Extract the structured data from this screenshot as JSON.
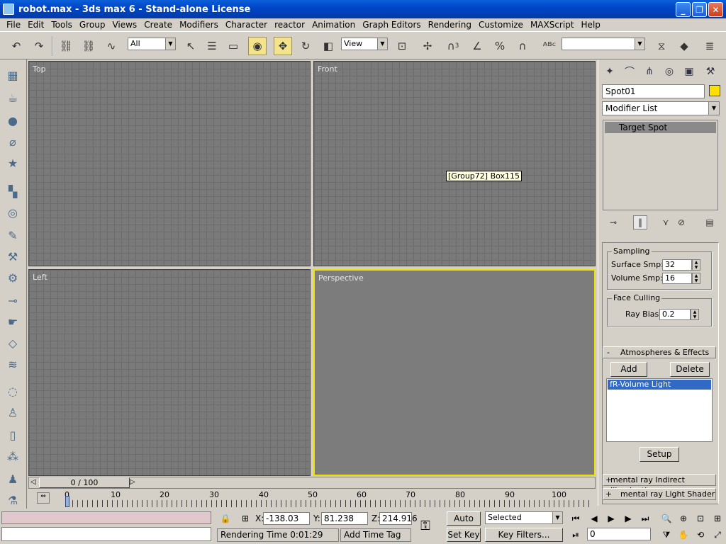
{
  "window": {
    "title": "robot.max - 3ds max 6 - Stand-alone License",
    "buttons": {
      "minimize": "_",
      "maximize": "❐",
      "close": "✕"
    }
  },
  "menu": [
    "File",
    "Edit",
    "Tools",
    "Group",
    "Views",
    "Create",
    "Modifiers",
    "Character",
    "reactor",
    "Animation",
    "Graph Editors",
    "Rendering",
    "Customize",
    "MAXScript",
    "Help"
  ],
  "toolbar": {
    "selection_filter": "All",
    "reference_coord": "View",
    "snap_angle": "3",
    "named_selection": ""
  },
  "viewports": {
    "top": {
      "label": "Top"
    },
    "front": {
      "label": "Front"
    },
    "left": {
      "label": "Left"
    },
    "perspective": {
      "label": "Perspective"
    }
  },
  "tooltip": "[Group72] Box115",
  "command_panel": {
    "object_name": "Spot01",
    "object_color": "#ffe000",
    "modifier_list": "Modifier List",
    "stack_item": "Target Spot",
    "sampling": {
      "title": "Sampling",
      "surface_label": "Surface Smp:",
      "surface_value": "32",
      "volume_label": "Volume Smp:",
      "volume_value": "16"
    },
    "face_culling": {
      "title": "Face Culling",
      "ray_bias_label": "Ray Bias:",
      "ray_bias_value": "0.2"
    },
    "atmospheres": {
      "toggle": "-",
      "title": "Atmospheres & Effects",
      "add": "Add",
      "delete": "Delete",
      "items": [
        "fR-Volume Light"
      ],
      "setup": "Setup"
    },
    "rollup_mr_indirect": {
      "toggle": "+",
      "title": "mental ray Indirect Illumination"
    },
    "rollup_mr_shader": {
      "toggle": "+",
      "title": "mental ray Light Shader"
    }
  },
  "time_slider": {
    "frame_display": "0 / 100",
    "ticks": [
      "0",
      "10",
      "20",
      "30",
      "40",
      "50",
      "60",
      "70",
      "80",
      "90",
      "100"
    ]
  },
  "status": {
    "x_label": "X:",
    "x_value": "-138.03",
    "y_label": "Y:",
    "y_value": "81.238",
    "z_label": "Z:",
    "z_value": "214.916",
    "rendering_time": "Rendering Time  0:01:29",
    "add_time_tag": "Add Time Tag",
    "auto_key": "Auto Key",
    "set_key": "Set Key",
    "key_mode": "Selected",
    "key_filters": "Key Filters...",
    "current_frame": "0"
  }
}
